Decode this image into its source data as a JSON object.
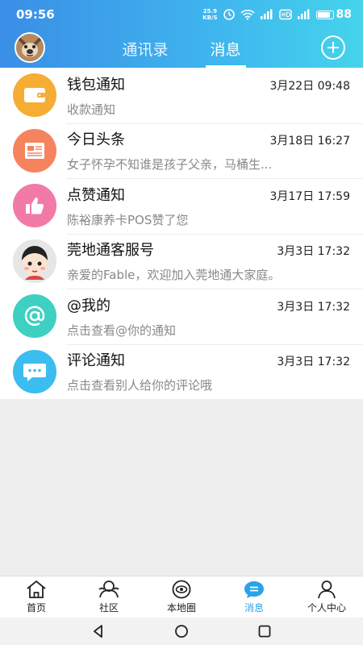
{
  "status_bar": {
    "time": "09:56",
    "net_speed_value": "25.9",
    "net_speed_unit": "KB/S",
    "battery": "88",
    "battery_level": 0.88
  },
  "header": {
    "tabs": [
      {
        "label": "通讯录",
        "active": false
      },
      {
        "label": "消息",
        "active": true
      }
    ]
  },
  "messages": [
    {
      "title": "钱包通知",
      "time": "3月22日 09:48",
      "subtitle": "收款通知",
      "icon": "wallet-icon",
      "color": "#f6ad33"
    },
    {
      "title": "今日头条",
      "time": "3月18日 16:27",
      "subtitle": "女子怀孕不知谁是孩子父亲，马桶生...",
      "icon": "newspaper-icon",
      "color": "#f5845e"
    },
    {
      "title": "点赞通知",
      "time": "3月17日 17:59",
      "subtitle": "陈裕康养卡POS赞了您",
      "icon": "thumbs-up-icon",
      "color": "#f27aa6"
    },
    {
      "title": "莞地通客服号",
      "time": "3月3日 17:32",
      "subtitle": "亲爱的Fable，欢迎加入莞地通大家庭。",
      "icon": "cartoon-avatar-icon",
      "color": "#e8e8e8"
    },
    {
      "title": "@我的",
      "time": "3月3日 17:32",
      "subtitle": "点击查看@你的通知",
      "icon": "at-sign-icon",
      "color": "#3ed0c0"
    },
    {
      "title": "评论通知",
      "time": "3月3日 17:32",
      "subtitle": "点击查看别人给你的评论哦",
      "icon": "comment-bubble-icon",
      "color": "#3bbdf0"
    }
  ],
  "bottom_nav": [
    {
      "label": "首页",
      "icon": "home-icon",
      "active": false
    },
    {
      "label": "社区",
      "icon": "community-icon",
      "active": false
    },
    {
      "label": "本地圈",
      "icon": "local-circle-icon",
      "active": false
    },
    {
      "label": "消息",
      "icon": "message-icon",
      "active": true
    },
    {
      "label": "个人中心",
      "icon": "profile-icon",
      "active": false
    }
  ],
  "colors": {
    "accent": "#2aa3e8",
    "header_start": "#3a8ee6",
    "header_end": "#45d4ec"
  }
}
